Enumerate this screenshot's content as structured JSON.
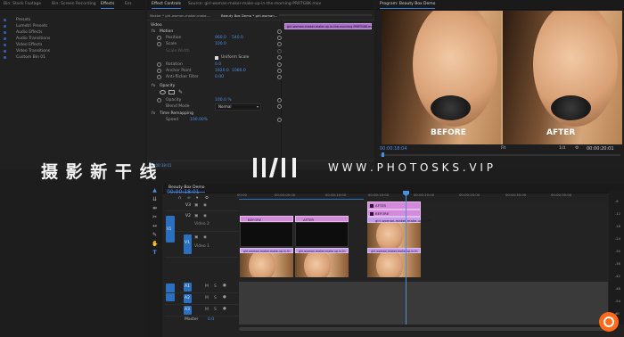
{
  "left_panel": {
    "tabs": [
      "Bin: Stock Footage",
      "Bin: Screen Recording",
      "Effects",
      "Ess"
    ],
    "items": [
      "Presets",
      "Lumetri Presets",
      "Audio Effects",
      "Audio Transitions",
      "Video Effects",
      "Video Transitions",
      "Custom Bin 01"
    ]
  },
  "effect_controls": {
    "tabs": [
      "Effect Controls",
      "Source: girl-woman-maker-make-up-in-the-morning-PRRTG8K.mov"
    ],
    "header_source": "Master * girl-woman-maker-make-...",
    "header_seq": "Beauty Box Demo * girl-woman...",
    "mini_clip": "girl-woman-maker-make-up-in-the-morning-PRRTG8K.mov",
    "section_video": "Video",
    "motion_label": "Motion",
    "rows": [
      {
        "label": "Position",
        "v1": "960.0",
        "v2": "540.0"
      },
      {
        "label": "Scale",
        "v1": "100.0",
        "v2": ""
      },
      {
        "label": "Scale Width",
        "v1": "",
        "v2": ""
      },
      {
        "label": "Uniform Scale",
        "v1": "",
        "v2": ""
      },
      {
        "label": "Rotation",
        "v1": "0.0",
        "v2": ""
      },
      {
        "label": "Anchor Point",
        "v1": "1920.0",
        "v2": "1080.0"
      },
      {
        "label": "Anti-flicker Filter",
        "v1": "0.00",
        "v2": ""
      }
    ],
    "opacity_label": "Opacity",
    "opacity_value": "100.0 %",
    "blend_label": "Blend Mode",
    "blend_value": "Normal",
    "time_remap": "Time Remapping",
    "speed_label": "Speed",
    "speed_value": "100.00%"
  },
  "program_monitor": {
    "title": "Program: Beauty Box Demo",
    "label_before": "BEFORE",
    "label_after": "AFTER",
    "timecode": "00:00:18:04",
    "fit": "Fit",
    "fraction": "1/4",
    "duration": "00:00:20:01"
  },
  "timeline": {
    "tab": "Beauty Box Demo",
    "timecode": "00:00:18:01",
    "ruler": [
      "00:00",
      "00:00:05:00",
      "00:00:10:00",
      "00:00:15:00",
      "00:00:20:00",
      "00:00:25:00",
      "00:00:30:00",
      "00:00:35:00"
    ],
    "tracks": [
      "V3",
      "V2",
      "V1",
      "A1",
      "A2",
      "A3"
    ],
    "video1_label": "Video 1",
    "video2_label": "Video 2",
    "master_label": "Master",
    "master_value": "0.0",
    "clips": {
      "after_label": "AFTER",
      "before_label": "BEFORE",
      "v3_1": "AFTER",
      "v3_2": "BEFORE",
      "v3_3": "girl-woman-maker-make-up-in-th",
      "v2_1": "girl-woman-make-up-in-t",
      "v2_2": "girl-woman-make-up-in-t",
      "v1_1": "girl-woman-maker-make-up-in-th",
      "v1_2": "girl-woman-maker-make-up-in-th",
      "v1_3": "girl-woman-maker-make-up-in-th"
    },
    "meter_labels": [
      "-6",
      "-12",
      "-18",
      "-24",
      "-30",
      "-36",
      "-42",
      "-48",
      "-54",
      "dB"
    ]
  },
  "watermark": {
    "chinese": "摄 影 新 干 线",
    "url": "W W W . P H O T O S K S . V I P"
  },
  "colors": {
    "accent": "#3b78d8",
    "clip_pink": "#d18bd9",
    "clip_lilac": "#c49be6",
    "track_blue": "#2b6fbf",
    "playhead": "#4a90e2",
    "logo_orange": "#ff6a1a"
  }
}
